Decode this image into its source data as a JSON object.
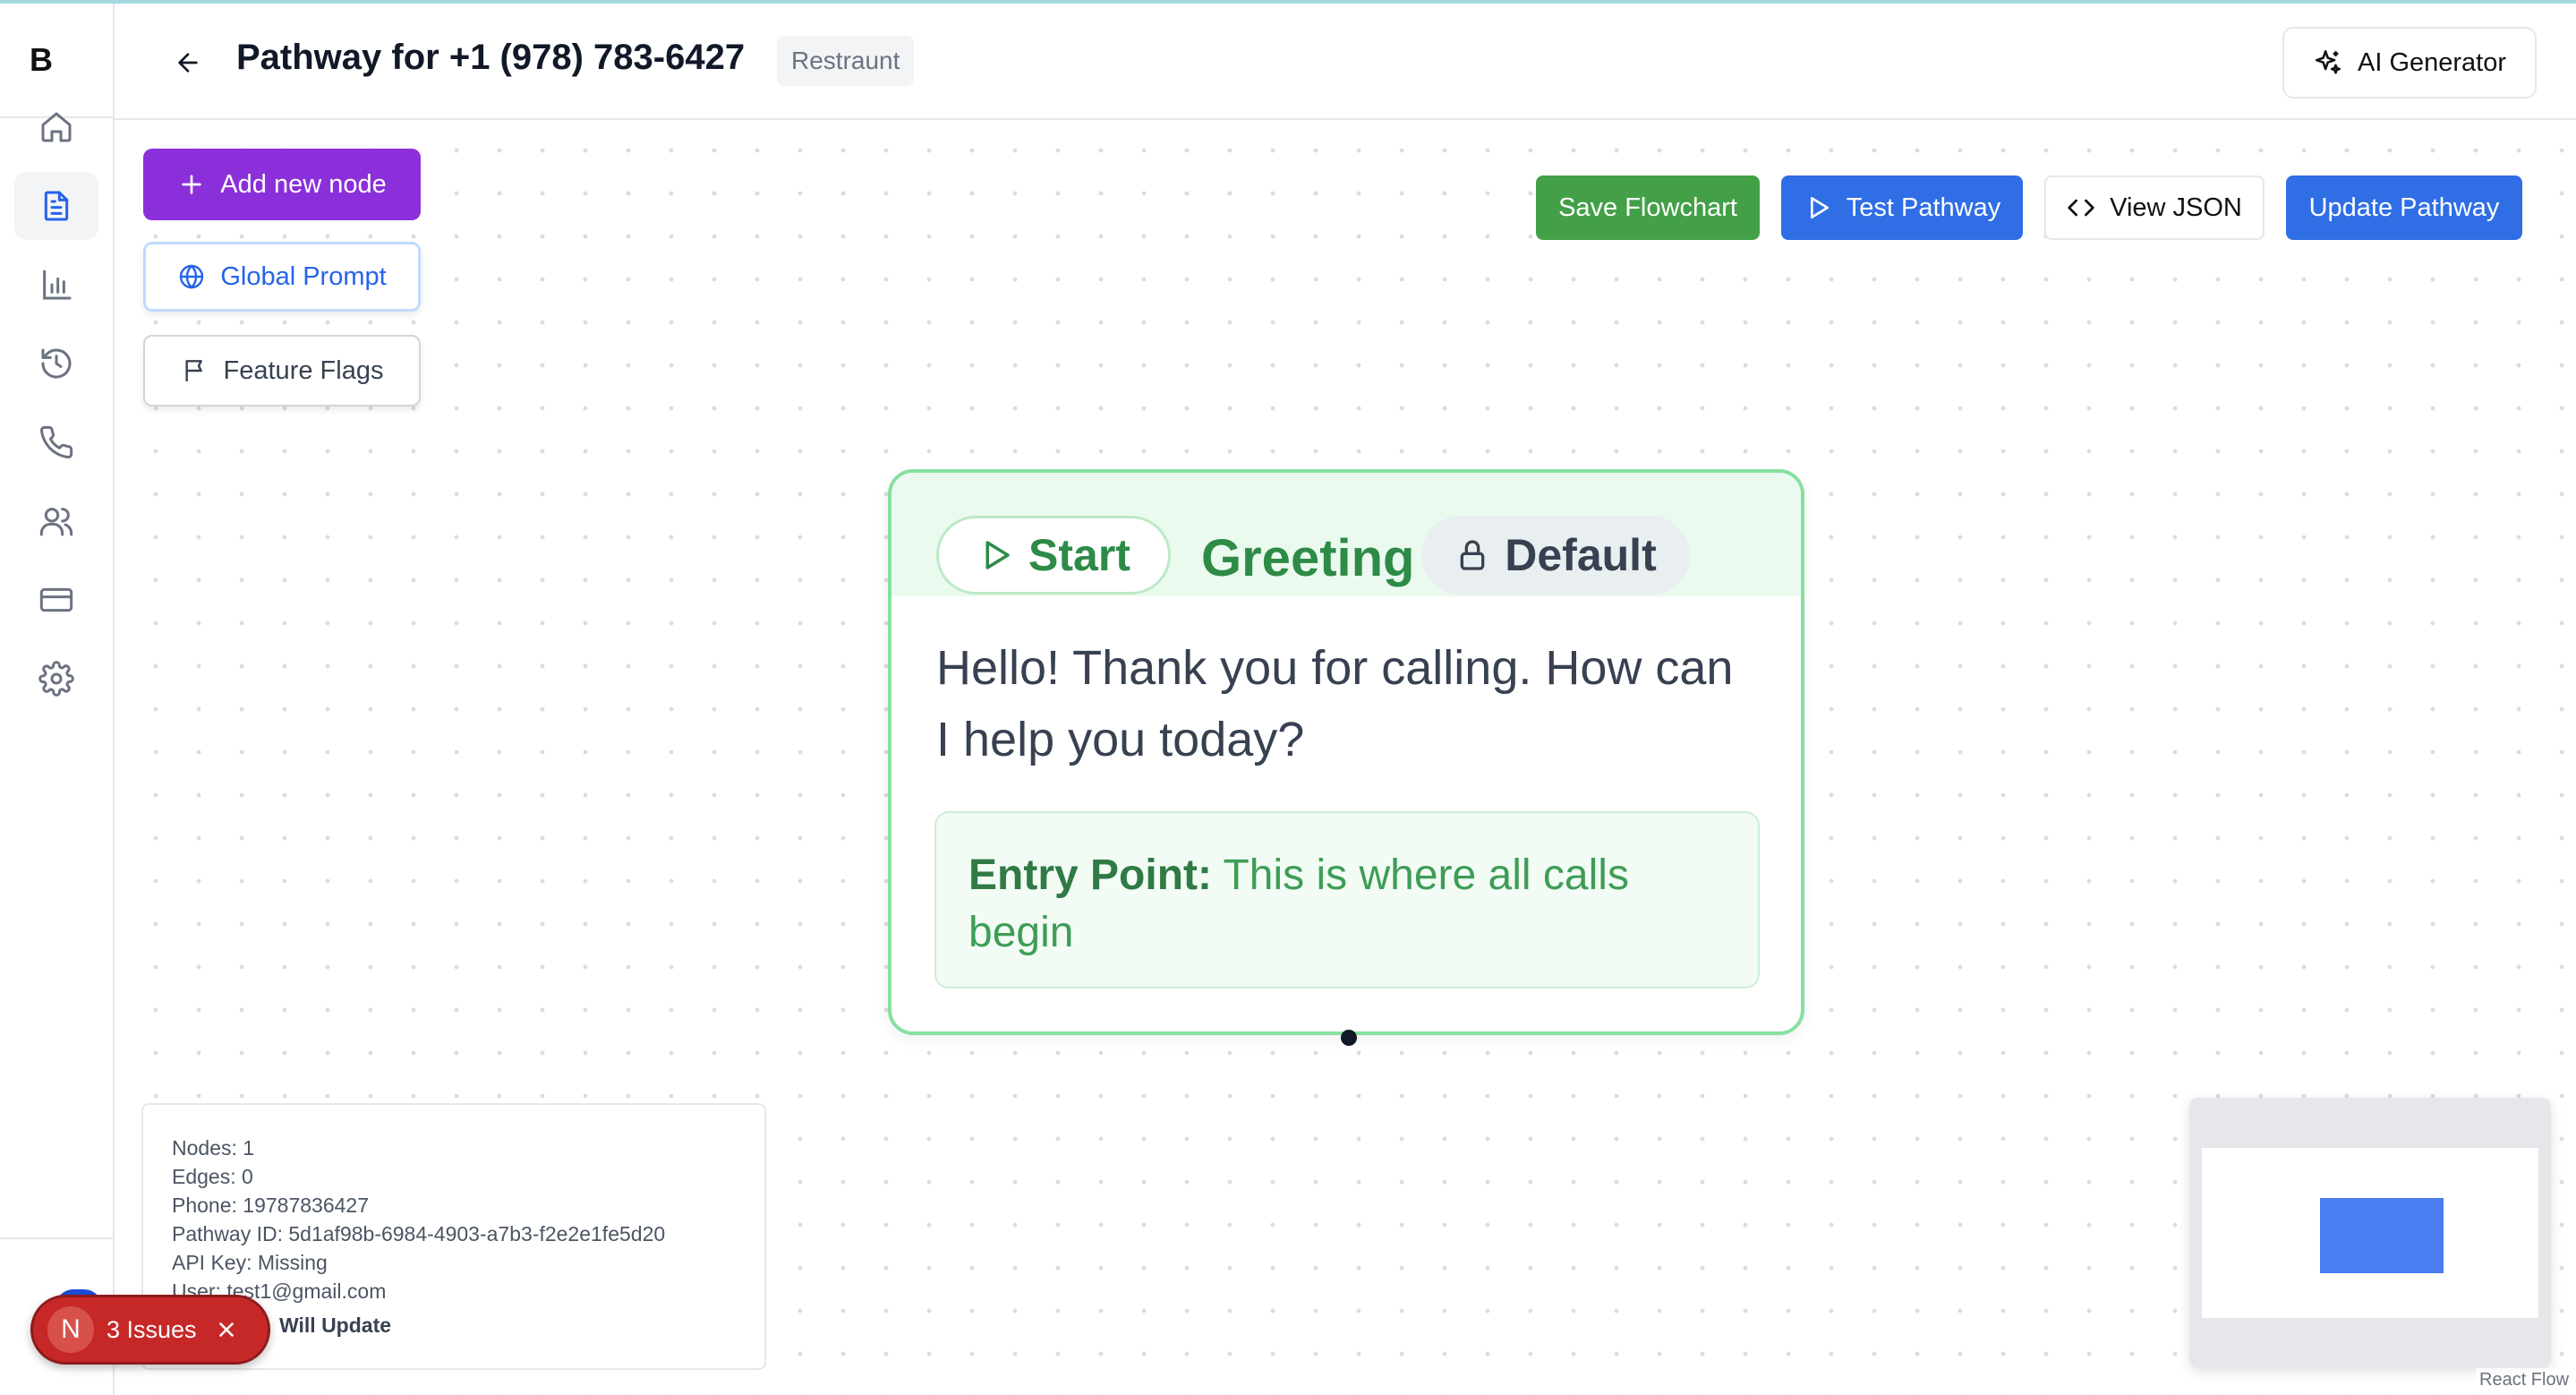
{
  "app": {
    "logo": "B"
  },
  "header": {
    "title": "Pathway for +1 (978) 783-6427",
    "tag": "Restraunt",
    "ai_generator_label": "AI Generator"
  },
  "sidebar": {
    "items": [
      {
        "name": "home",
        "icon": "home-icon"
      },
      {
        "name": "pathways",
        "icon": "document-icon",
        "active": true
      },
      {
        "name": "analytics",
        "icon": "bar-chart-icon"
      },
      {
        "name": "history",
        "icon": "history-icon"
      },
      {
        "name": "calls",
        "icon": "phone-icon"
      },
      {
        "name": "users",
        "icon": "users-icon"
      },
      {
        "name": "billing",
        "icon": "credit-card-icon"
      },
      {
        "name": "settings",
        "icon": "gear-icon"
      }
    ]
  },
  "toolbar": {
    "add_node_label": "Add new node",
    "global_prompt_label": "Global Prompt",
    "feature_flags_label": "Feature Flags",
    "save_label": "Save Flowchart",
    "test_label": "Test Pathway",
    "view_json_label": "View JSON",
    "update_label": "Update Pathway"
  },
  "colors": {
    "add_node": "#8b2fdb",
    "save": "#43a047",
    "primary": "#2f6ee5",
    "node_border": "#86e0a0",
    "issues": "#c62828"
  },
  "node": {
    "start_label": "Start",
    "title": "Greeting",
    "default_label": "Default",
    "message": "Hello! Thank you for calling. How can I help you today?",
    "entry_label": "Entry Point:",
    "entry_text": "This is where all calls begin"
  },
  "info": {
    "nodes": "Nodes: 1",
    "edges": "Edges: 0",
    "phone": "Phone: 19787836427",
    "pathway_id": "Pathway ID: 5d1af98b-6984-4903-a7b3-f2e2e1fe5d20",
    "api_key": "API Key: Missing",
    "user": "User: test1@gmail.com",
    "update_status": "Will Update"
  },
  "issues": {
    "avatar": "N",
    "label": "3 Issues"
  },
  "minimap": {
    "attribution": "React Flow"
  }
}
